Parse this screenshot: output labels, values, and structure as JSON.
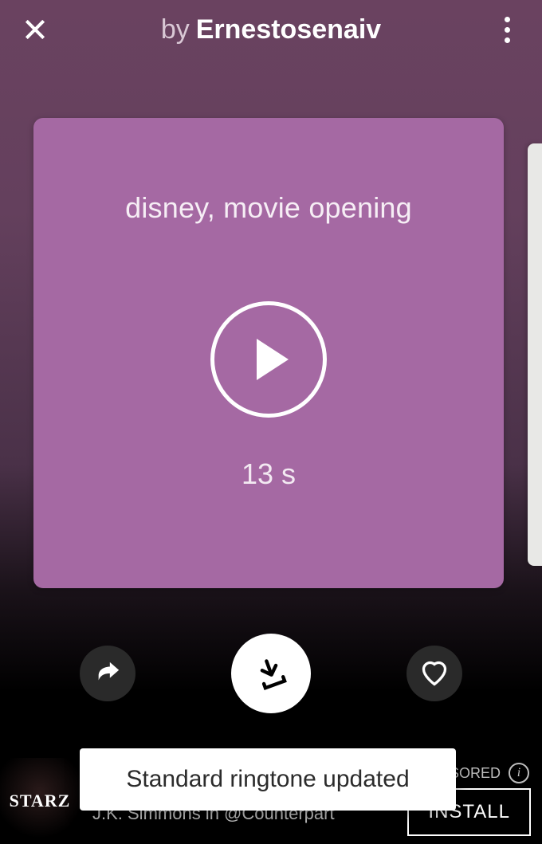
{
  "header": {
    "by_label": "by",
    "author": "Ernestosenaiv"
  },
  "card": {
    "title": "disney, movie opening",
    "duration_label": "13 s"
  },
  "toast": {
    "message": "Standard ringtone updated"
  },
  "ad": {
    "logo_text": "STARZ",
    "sponsored_label": "SORED",
    "subtitle": "J.K. Simmons in @Counterpart",
    "install_label": "INSTALL"
  }
}
